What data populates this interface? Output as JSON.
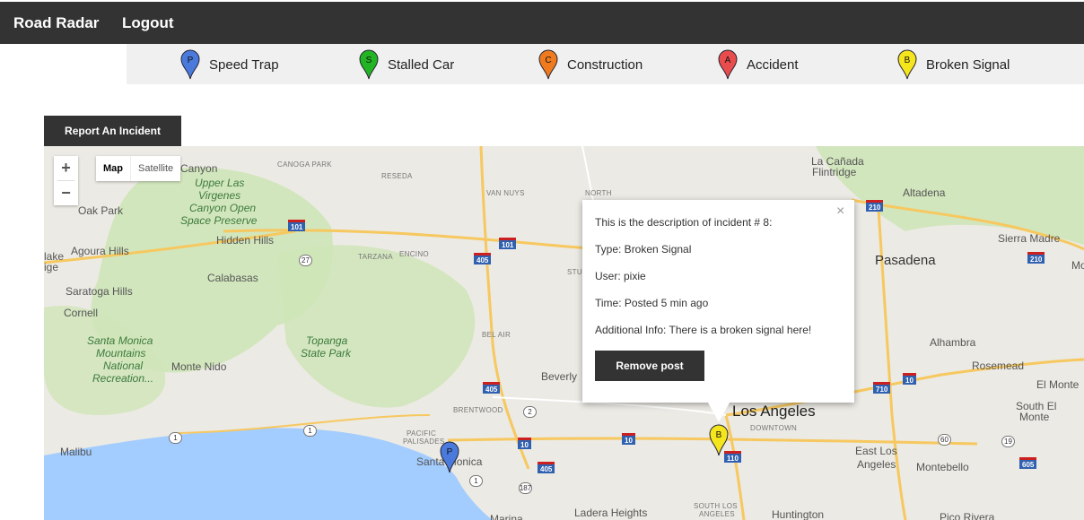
{
  "nav": {
    "brand": "Road Radar",
    "logout": "Logout"
  },
  "legend": [
    {
      "label": "Speed Trap",
      "letter": "P",
      "color": "#4a7bdc",
      "icon": "speed-trap-marker-icon"
    },
    {
      "label": "Stalled Car",
      "letter": "S",
      "color": "#22b422",
      "icon": "stalled-car-marker-icon"
    },
    {
      "label": "Construction",
      "letter": "C",
      "color": "#f07b1f",
      "icon": "construction-marker-icon"
    },
    {
      "label": "Accident",
      "letter": "A",
      "color": "#e84c4c",
      "icon": "accident-marker-icon"
    },
    {
      "label": "Broken Signal",
      "letter": "B",
      "color": "#f5e51c",
      "icon": "broken-signal-marker-icon"
    }
  ],
  "report_button": "Report An Incident",
  "map": {
    "zoom_in": "+",
    "zoom_out": "−",
    "type_map": "Map",
    "type_satellite": "Satellite",
    "water_color": "#a3ccff",
    "park_color": "#cfe5b8",
    "labels": [
      "Canyon",
      "Upper Las",
      "Virgenes",
      "Canyon Open",
      "Space Preserve",
      "Oak Park",
      "Hidden Hills",
      "Agoura Hills",
      "lake",
      "ige",
      "Calabasas",
      "Saratoga Hills",
      "Cornell",
      "Santa Monica",
      "Mountains",
      "National",
      "Recreation...",
      "Monte Nido",
      "Topanga",
      "State Park",
      "CANOGA PARK",
      "RESEDA",
      "VAN NUYS",
      "NORTH",
      "TARZANA",
      "ENCINO",
      "BEL AIR",
      "Beverly",
      "BRENTWOOD",
      "PACIFIC",
      "PALISADES",
      "Santa Monica",
      "Malibu",
      "Marina",
      "Ladera Heights",
      "SOUTH LOS",
      "ANGELES",
      "Huntington",
      "La Cañada",
      "Flintridge",
      "Altadena",
      "Sierra Madre",
      "Pasadena",
      "Mo",
      "Alhambra",
      "Rosemead",
      "El Monte",
      "South El",
      "Monte",
      "Los Angeles",
      "DOWNTOWN",
      "East Los",
      "Angeles",
      "Montebello",
      "Pico Rivera",
      "STU"
    ],
    "highways": [
      "101",
      "101",
      "405",
      "405",
      "405",
      "10",
      "10",
      "110",
      "210",
      "210",
      "710",
      "10",
      "605"
    ],
    "routes": [
      "27",
      "1",
      "1",
      "2",
      "1",
      "187",
      "60",
      "19"
    ]
  },
  "markers": [
    {
      "letter": "P",
      "color": "#4a7bdc",
      "name": "speed-trap-map-marker"
    },
    {
      "letter": "B",
      "color": "#f5e51c",
      "name": "broken-signal-map-marker"
    }
  ],
  "popup": {
    "description": "This is the description of incident # 8:",
    "type": "Type: Broken Signal",
    "user": "User: pixie",
    "time": "Time: Posted 5 min ago",
    "info": "Additional Info: There is a broken signal here!",
    "remove": "Remove post",
    "close": "×"
  }
}
